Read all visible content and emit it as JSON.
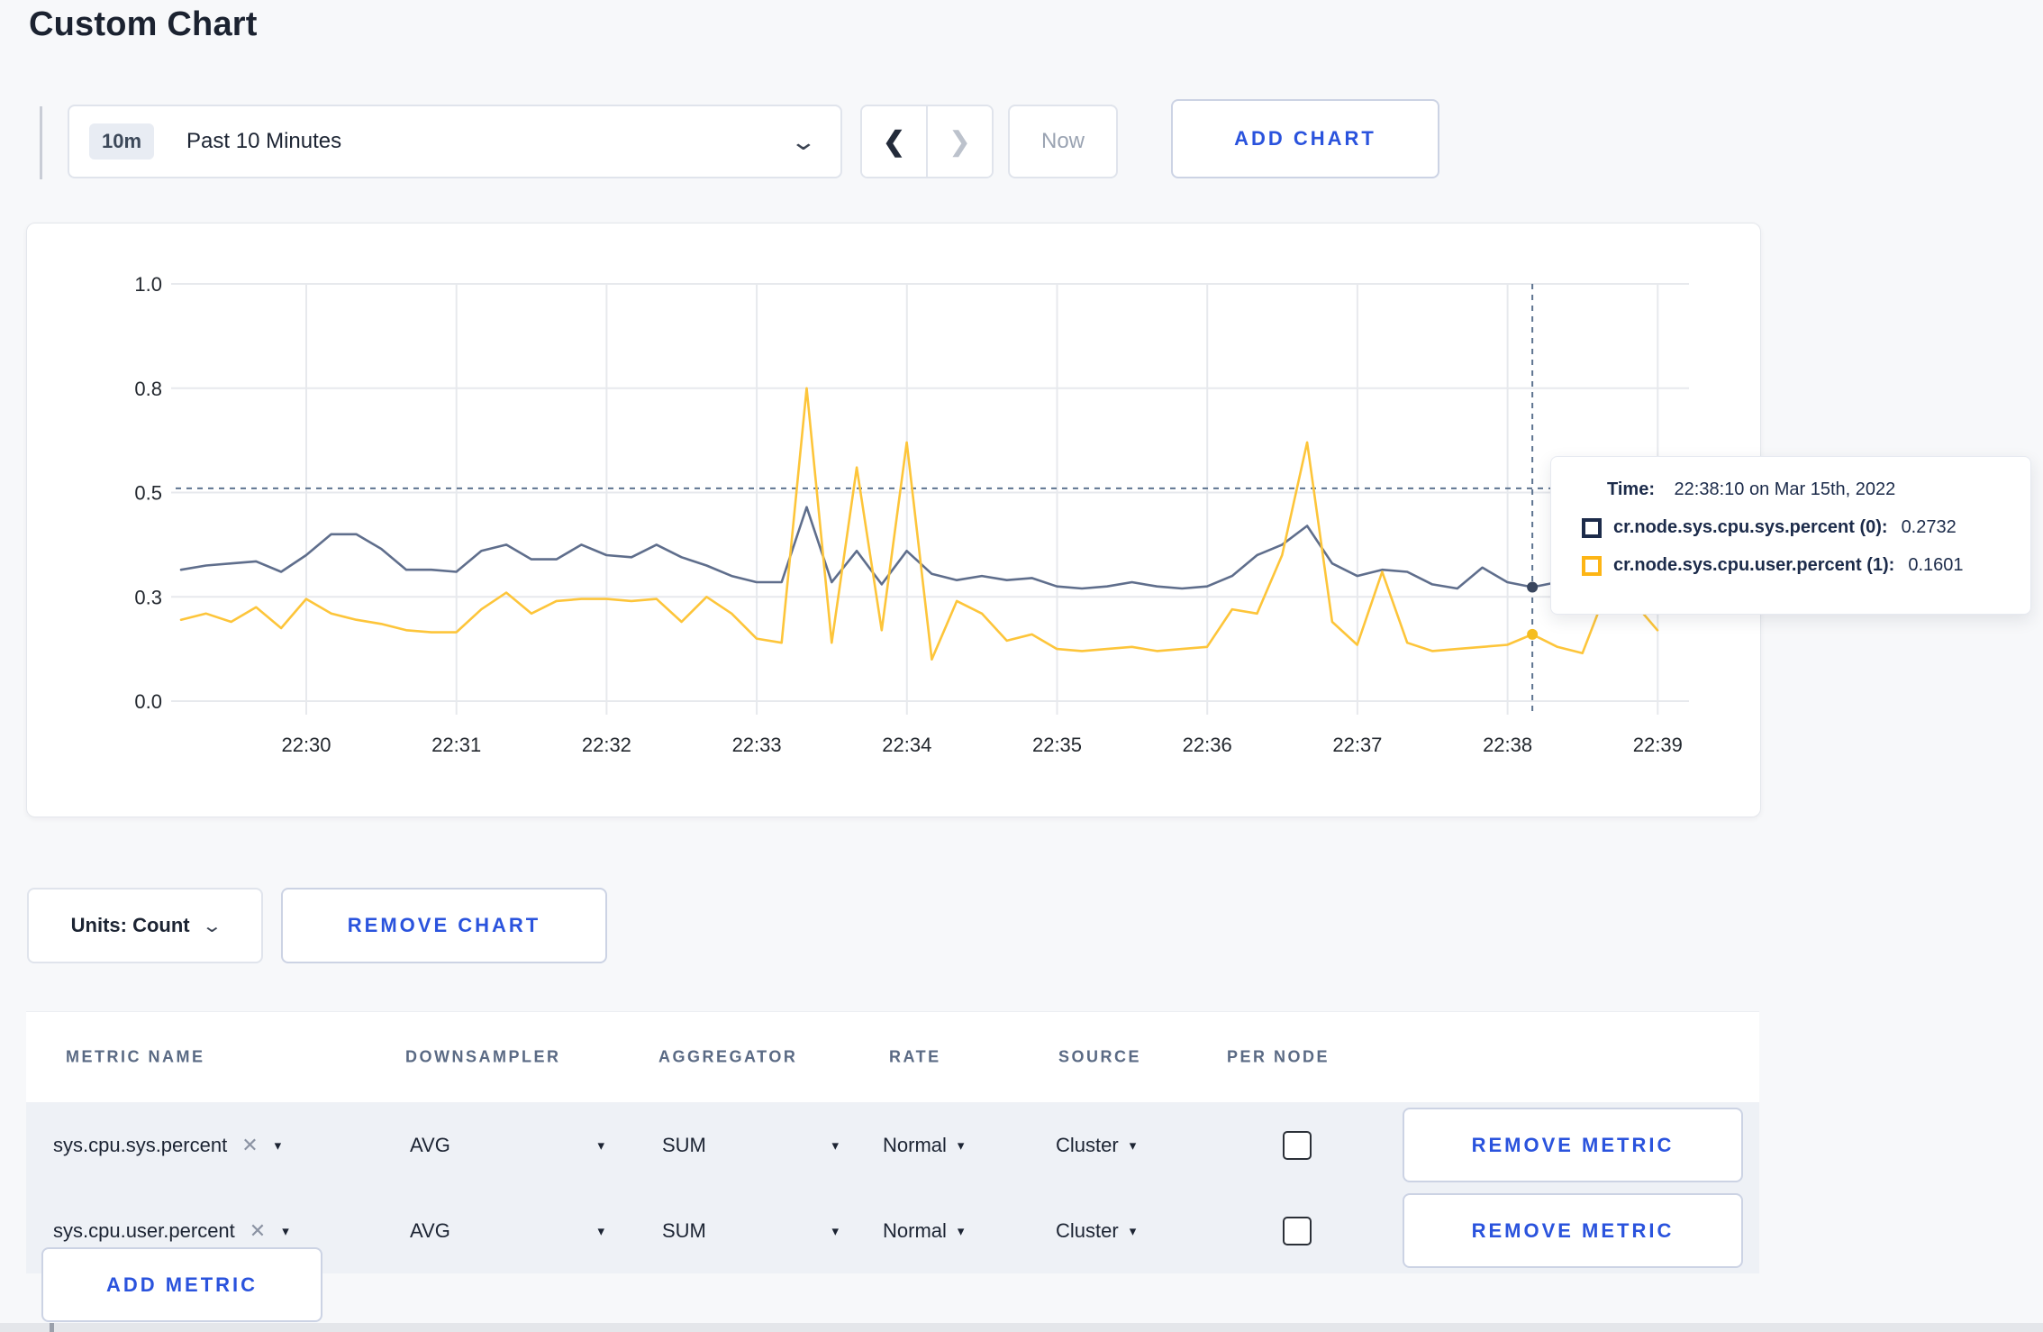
{
  "page": {
    "title": "Custom Chart"
  },
  "icons": {
    "prev": "❮",
    "next": "❯",
    "chevron_down": "⌄",
    "caret_down": "▾",
    "remove_x": "✕"
  },
  "colors": {
    "accent_blue": "#2a53dd",
    "sys_line": "#5f6e8c",
    "user_line": "#fdc53a",
    "sys_legend": "#1c2b4a",
    "user_legend": "#fdb515",
    "crosshair": "#5e7490",
    "gridline": "#e7e9ed"
  },
  "toolbar": {
    "time_range": {
      "badge": "10m",
      "label": "Past 10 Minutes"
    },
    "now_label": "Now",
    "add_chart_label": "ADD CHART"
  },
  "tooltip": {
    "time_label": "Time:",
    "time_value": "22:38:10 on Mar 15th, 2022",
    "entries": [
      {
        "label": "cr.node.sys.cpu.sys.percent (0):",
        "value": "0.2732",
        "color": "#1c2b4a"
      },
      {
        "label": "cr.node.sys.cpu.user.percent (1):",
        "value": "0.1601",
        "color": "#fdb515"
      }
    ]
  },
  "units_row": {
    "units_label": "Units: Count",
    "remove_chart_label": "REMOVE CHART"
  },
  "metrics_table": {
    "headers": [
      "METRIC NAME",
      "DOWNSAMPLER",
      "AGGREGATOR",
      "RATE",
      "SOURCE",
      "PER NODE"
    ],
    "rows": [
      {
        "metric": "sys.cpu.sys.percent",
        "downsampler": "AVG",
        "aggregator": "SUM",
        "rate": "Normal",
        "source": "Cluster",
        "per_node": false,
        "remove_label": "REMOVE METRIC"
      },
      {
        "metric": "sys.cpu.user.percent",
        "downsampler": "AVG",
        "aggregator": "SUM",
        "rate": "Normal",
        "source": "Cluster",
        "per_node": false,
        "remove_label": "REMOVE METRIC"
      }
    ],
    "add_metric_label": "ADD METRIC"
  },
  "chart_data": {
    "type": "line",
    "title": "",
    "xlabel": "",
    "ylabel": "",
    "x_start": "22:29:10",
    "x_step_seconds": 10,
    "x_tick_labels": [
      "22:30",
      "22:31",
      "22:32",
      "22:33",
      "22:34",
      "22:35",
      "22:36",
      "22:37",
      "22:38",
      "22:39"
    ],
    "y_tick_values": [
      0,
      0.25,
      0.5,
      0.75,
      1.0
    ],
    "y_tick_labels": [
      "0.0",
      "0.3",
      "0.5",
      "0.8",
      "1.0"
    ],
    "ylim": [
      0,
      1
    ],
    "grid": true,
    "legend_position": "tooltip",
    "series": [
      {
        "name": "cr.node.sys.cpu.sys.percent",
        "color": "#5f6e8c",
        "values": [
          0.315,
          0.325,
          0.33,
          0.335,
          0.31,
          0.35,
          0.4,
          0.4,
          0.365,
          0.315,
          0.315,
          0.31,
          0.36,
          0.375,
          0.34,
          0.34,
          0.375,
          0.35,
          0.345,
          0.375,
          0.345,
          0.325,
          0.3,
          0.285,
          0.285,
          0.465,
          0.285,
          0.36,
          0.28,
          0.36,
          0.305,
          0.29,
          0.3,
          0.29,
          0.295,
          0.275,
          0.27,
          0.275,
          0.285,
          0.275,
          0.27,
          0.275,
          0.3,
          0.35,
          0.375,
          0.42,
          0.33,
          0.3,
          0.315,
          0.31,
          0.28,
          0.27,
          0.32,
          0.285,
          0.2732,
          0.285,
          0.28,
          0.29,
          0.3,
          0.295
        ]
      },
      {
        "name": "cr.node.sys.cpu.user.percent",
        "color": "#fdc53a",
        "values": [
          0.195,
          0.21,
          0.19,
          0.225,
          0.175,
          0.245,
          0.21,
          0.195,
          0.185,
          0.17,
          0.165,
          0.165,
          0.22,
          0.26,
          0.21,
          0.24,
          0.245,
          0.245,
          0.24,
          0.245,
          0.19,
          0.25,
          0.21,
          0.15,
          0.14,
          0.75,
          0.14,
          0.56,
          0.17,
          0.62,
          0.1,
          0.24,
          0.21,
          0.145,
          0.16,
          0.125,
          0.12,
          0.125,
          0.13,
          0.12,
          0.125,
          0.13,
          0.22,
          0.21,
          0.35,
          0.62,
          0.19,
          0.135,
          0.31,
          0.14,
          0.12,
          0.125,
          0.13,
          0.135,
          0.1601,
          0.13,
          0.115,
          0.27,
          0.24,
          0.17
        ]
      }
    ],
    "crosshair": {
      "time": "22:38:10",
      "index": 54,
      "hover_value": 0.51,
      "series_values": [
        0.2732,
        0.1601
      ]
    }
  }
}
